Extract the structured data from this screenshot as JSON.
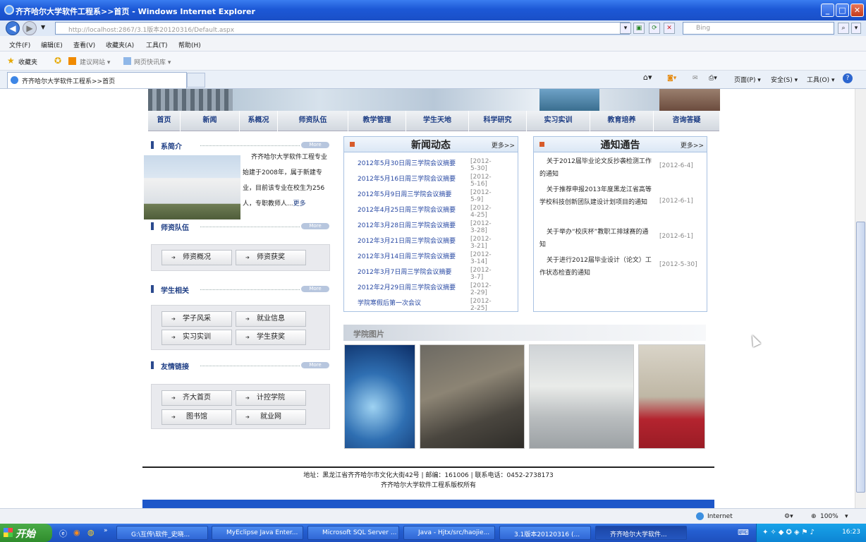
{
  "window": {
    "title": "齐齐哈尔大学软件工程系>>首页 - Windows Internet Explorer",
    "min": "_",
    "max": "□",
    "close": "✕"
  },
  "address": {
    "url": "http://localhost:2867/3.1版本20120316/Default.aspx",
    "search_placeholder": "Bing"
  },
  "menu": [
    "文件(F)",
    "编辑(E)",
    "查看(V)",
    "收藏夹(A)",
    "工具(T)",
    "帮助(H)"
  ],
  "favbar": {
    "favorites": "收藏夹",
    "suggested": "建议网站 ▾",
    "webslice": "网页快讯库 ▾"
  },
  "tab": {
    "title": "齐齐哈尔大学软件工程系>>首页"
  },
  "cmdbar": {
    "page": "页面(P) ▾",
    "safety": "安全(S) ▾",
    "tools": "工具(O) ▾",
    "help": "?"
  },
  "nav": [
    "首页",
    "新闻",
    "系概况",
    "师资队伍",
    "教学管理",
    "学生天地",
    "科学研究",
    "实习实训",
    "教育培养",
    "咨询答疑"
  ],
  "intro": {
    "title": "系简介",
    "text": "齐齐哈尔大学软件工程专业始建于2008年，属于新建专业，目前该专业在校生为256人，专职教师人...",
    "more_link": "更多",
    "more_badge": "More"
  },
  "faculty": {
    "title": "师资队伍",
    "more_badge": "More",
    "buttons": [
      "师资概况",
      "师资获奖"
    ]
  },
  "students": {
    "title": "学生相关",
    "more_badge": "More",
    "buttons": [
      "学子风采",
      "就业信息",
      "实习实训",
      "学生获奖"
    ]
  },
  "links": {
    "title": "友情链接",
    "more_badge": "More",
    "buttons": [
      "齐大首页",
      "计控学院",
      "图书馆",
      "就业网"
    ]
  },
  "news": {
    "title": "新闻动态",
    "more": "更多>>",
    "items": [
      {
        "text": "2012年5月30日周三学院会议摘要",
        "date": "[2012-5-30]"
      },
      {
        "text": "2012年5月16日周三学院会议摘要",
        "date": "[2012-5-16]"
      },
      {
        "text": "2012年5月9日周三学院会议摘要",
        "date": "[2012-5-9]"
      },
      {
        "text": "2012年4月25日周三学院会议摘要",
        "date": "[2012-4-25]"
      },
      {
        "text": "2012年3月28日周三学院会议摘要",
        "date": "[2012-3-28]"
      },
      {
        "text": "2012年3月21日周三学院会议摘要",
        "date": "[2012-3-21]"
      },
      {
        "text": "2012年3月14日周三学院会议摘要",
        "date": "[2012-3-14]"
      },
      {
        "text": "2012年3月7日周三学院会议摘要",
        "date": "[2012-3-7]"
      },
      {
        "text": "2012年2月29日周三学院会议摘要",
        "date": "[2012-2-29]"
      },
      {
        "text": "学院寒假后第一次会议",
        "date": "[2012-2-25]"
      }
    ]
  },
  "notice": {
    "title": "通知通告",
    "more": "更多>>",
    "items": [
      {
        "text": "关于2012届毕业论文反抄袭检测工作的通知",
        "date": "[2012-6-4]"
      },
      {
        "text": "关于推荐申报2013年度黑龙江省高等学校科技创新团队建设计划项目的通知",
        "date": "[2012-6-1]"
      },
      {
        "text": "关于举办“校庆杯”教职工排球赛的通知",
        "date": "[2012-6-1]"
      },
      {
        "text": "关于进行2012届毕业设计（论文）工作状态检查的通知",
        "date": "[2012-5-30]"
      }
    ]
  },
  "photos": {
    "title": "学院图片"
  },
  "footer": {
    "line1": "地址：黑龙江省齐齐哈尔市文化大街42号 | 邮编：161006 | 联系电话：0452-2738173",
    "line2": "齐齐哈尔大学软件工程系版权所有"
  },
  "status": {
    "zone": "Internet",
    "zoom": "100%"
  },
  "taskbar": {
    "start": "开始",
    "tasks": [
      "G:\\互传\\软件_史晓...",
      "MyEclipse Java Enter...",
      "Microsoft SQL Server ...",
      "Java - Hjtx/src/haojie...",
      "3.1版本20120316 (...",
      "齐齐哈尔大学软件..."
    ],
    "clock": "16:23"
  }
}
